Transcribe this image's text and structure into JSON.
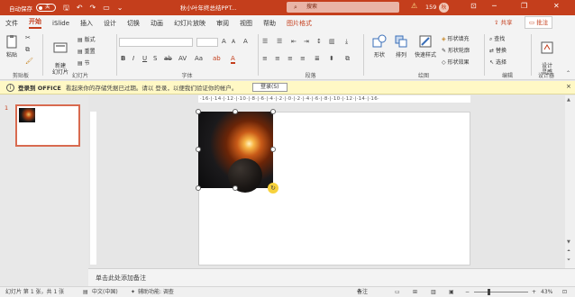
{
  "titlebar": {
    "autosave_label": "自动保存",
    "autosave_state": "关",
    "doc_title": "秋小叶年终总结PPT...",
    "search_placeholder": "搜索",
    "notification_count": "159",
    "avatar_initial": "秋",
    "minimize_glyph": "─",
    "restore_glyph": "❐",
    "close_glyph": "✕",
    "save_glyph": "🖫",
    "undo_glyph": "↶",
    "redo_glyph": "↷",
    "present_glyph": "▭",
    "qat_more_glyph": "⌄",
    "accent": "#c43e1c"
  },
  "tabs": [
    {
      "label": "文件"
    },
    {
      "label": "开始"
    },
    {
      "label": "iSlide"
    },
    {
      "label": "插入"
    },
    {
      "label": "设计"
    },
    {
      "label": "切换"
    },
    {
      "label": "动画"
    },
    {
      "label": "幻灯片放映"
    },
    {
      "label": "审阅"
    },
    {
      "label": "视图"
    },
    {
      "label": "帮助"
    },
    {
      "label": "图片格式"
    }
  ],
  "tabbar": {
    "share_label": "共享",
    "comment_label": "批注"
  },
  "ribbon": {
    "clipboard": {
      "paste": "粘贴",
      "group": "剪贴板"
    },
    "slides": {
      "new_slide": "新建\n幻灯片",
      "layout": "版式",
      "reset": "重置",
      "section": "节",
      "group": "幻灯片"
    },
    "font": {
      "group": "字体"
    },
    "paragraph": {
      "group": "段落"
    },
    "drawing": {
      "shape": "形状",
      "arrange": "排列",
      "quick_styles": "快速样式",
      "fill": "形状填充",
      "outline": "形状轮廓",
      "effects": "形状效果",
      "group": "绘图"
    },
    "editing": {
      "find": "查找",
      "replace": "替换",
      "select": "选择",
      "group": "编辑"
    },
    "designer": {
      "design_ideas": "设计\n灵感",
      "group": "设计器"
    }
  },
  "infobar": {
    "icon": "i",
    "title": "登录到 OFFICE",
    "message": "看起来你的存储凭据已过期。请以 登录，以便我们验证你的帐户。",
    "button": "登录(S)",
    "close": "×"
  },
  "slides_panel": {
    "slide_number": "1"
  },
  "ruler": {
    "text": "·16·|·14·|·12·|·10·|·8·|·6·|·4·|·2·|·0·|·2·|·4·|·6·|·8·|·10·|·12·|·14·|·16·"
  },
  "notes": {
    "placeholder": "单击此处添加备注"
  },
  "status": {
    "slide_info": "幻灯片 第 1 张，共 1 张",
    "language": "中文(中国)",
    "accessibility": "辅助功能: 调查",
    "notes_button": "备注",
    "zoom": "43%"
  }
}
